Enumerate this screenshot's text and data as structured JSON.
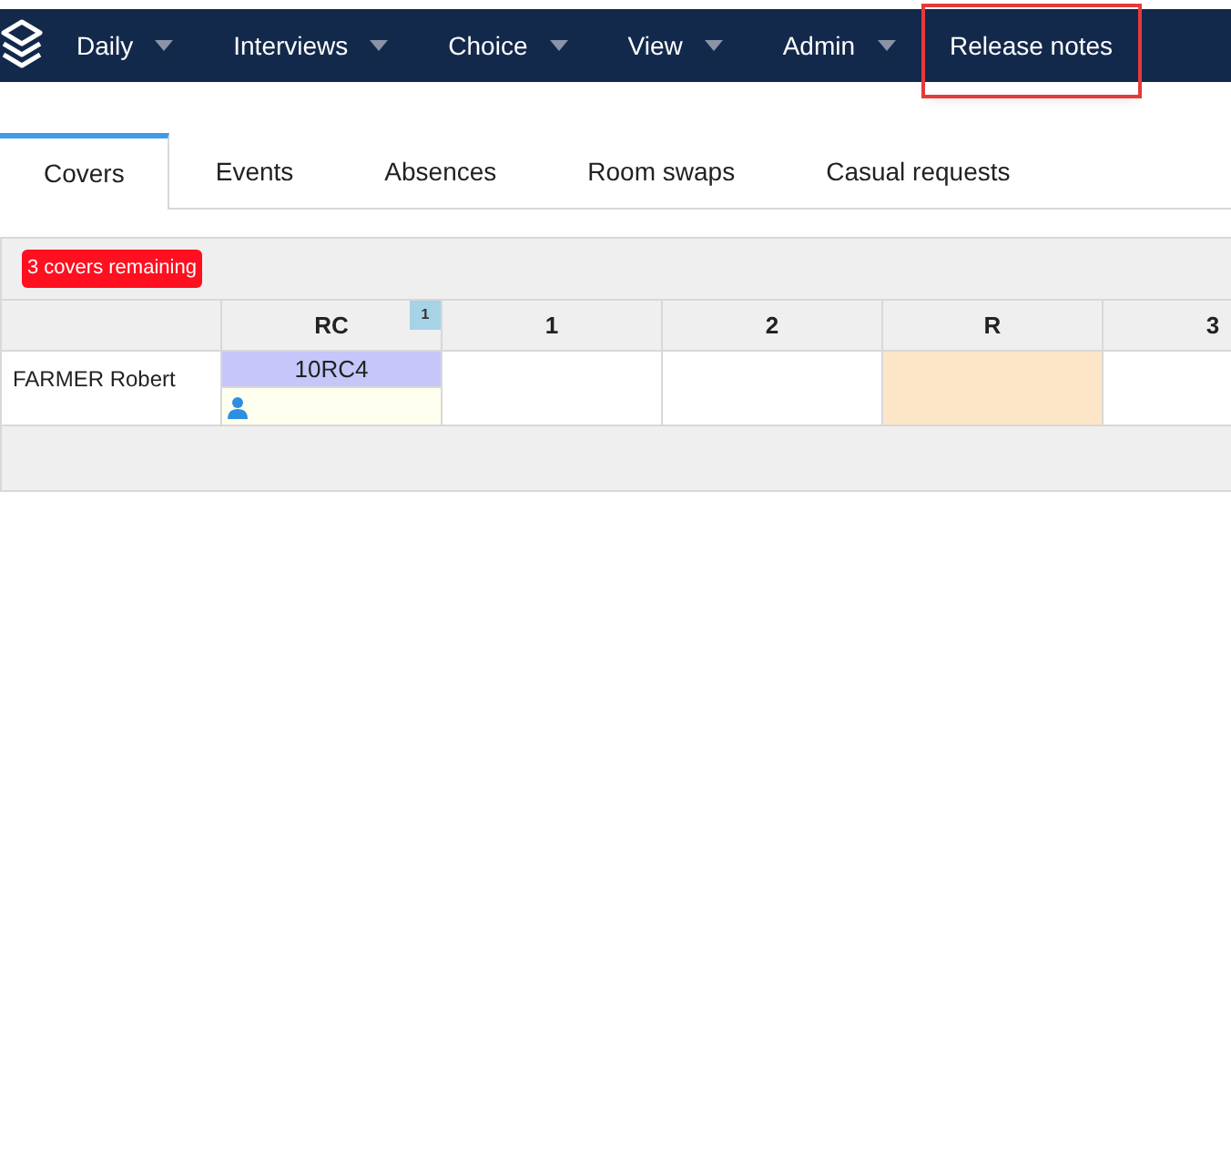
{
  "nav": {
    "items": [
      {
        "label": "Daily",
        "dropdown": true,
        "highlighted": false
      },
      {
        "label": "Interviews",
        "dropdown": true,
        "highlighted": false
      },
      {
        "label": "Choice",
        "dropdown": true,
        "highlighted": false
      },
      {
        "label": "View",
        "dropdown": true,
        "highlighted": false
      },
      {
        "label": "Admin",
        "dropdown": true,
        "highlighted": false
      },
      {
        "label": "Release notes",
        "dropdown": false,
        "highlighted": true
      }
    ]
  },
  "tabs": [
    {
      "label": "Covers",
      "selected": true
    },
    {
      "label": "Events",
      "selected": false
    },
    {
      "label": "Absences",
      "selected": false
    },
    {
      "label": "Room swaps",
      "selected": false
    },
    {
      "label": "Casual requests",
      "selected": false
    }
  ],
  "covers_badge": "3 covers remaining",
  "table": {
    "columns": [
      {
        "label": "RC",
        "count": "1"
      },
      {
        "label": "1"
      },
      {
        "label": "2"
      },
      {
        "label": "R"
      },
      {
        "label": "3"
      }
    ],
    "rows": [
      {
        "name": "FARMER Robert",
        "cells": [
          {
            "kind": "cover",
            "text": "10RC4"
          },
          {
            "kind": "empty"
          },
          {
            "kind": "empty"
          },
          {
            "kind": "break"
          },
          {
            "kind": "empty"
          }
        ]
      }
    ]
  }
}
